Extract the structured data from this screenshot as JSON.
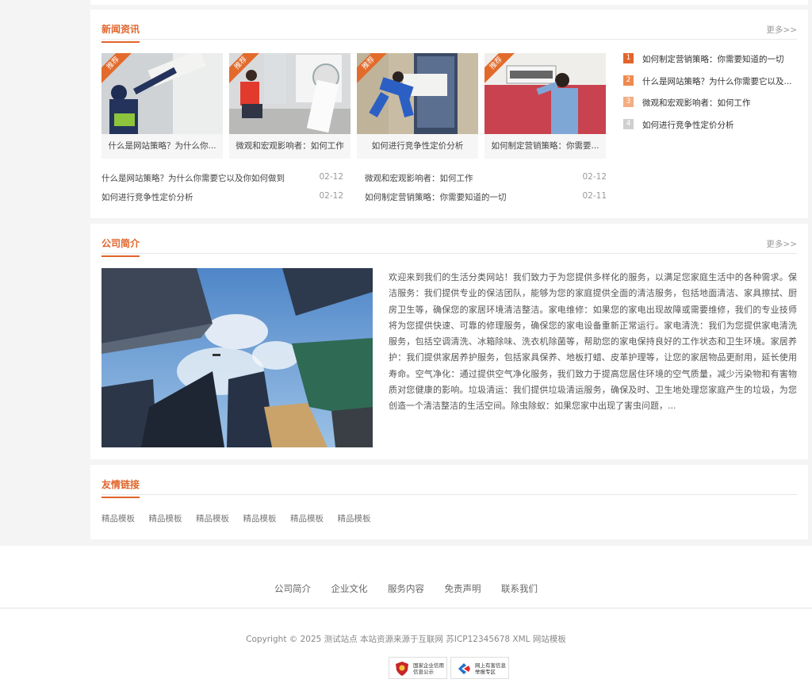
{
  "news": {
    "title": "新闻资讯",
    "more": "更多>>",
    "ribbon": "推荐",
    "thumbs": [
      {
        "caption": "什么是网站策略？为什么你..."
      },
      {
        "caption": "微观和宏观影响者：如何工作"
      },
      {
        "caption": "如何进行竞争性定价分析"
      },
      {
        "caption": "如何制定营销策略：你需要..."
      }
    ],
    "hot": [
      {
        "num": "1",
        "text": "如何制定营销策略：你需要知道的一切",
        "color": "#e0652b"
      },
      {
        "num": "2",
        "text": "什么是网站策略？为什么你需要它以及...",
        "color": "#ef8a4e"
      },
      {
        "num": "3",
        "text": "微观和宏观影响者：如何工作",
        "color": "#f2ad83"
      },
      {
        "num": "4",
        "text": "如何进行竞争性定价分析",
        "color": "#cfcfcf"
      }
    ],
    "list": [
      {
        "title": "什么是网站策略？为什么你需要它以及你如何做到",
        "date": "02-12"
      },
      {
        "title": "微观和宏观影响者：如何工作",
        "date": "02-12"
      },
      {
        "title": "如何进行竞争性定价分析",
        "date": "02-12"
      },
      {
        "title": "如何制定营销策略：你需要知道的一切",
        "date": "02-11"
      }
    ]
  },
  "about": {
    "title": "公司简介",
    "more": "更多>>",
    "text": "欢迎来到我们的生活分类网站！我们致力于为您提供多样化的服务，以满足您家庭生活中的各种需求。保洁服务：我们提供专业的保洁团队，能够为您的家庭提供全面的清洁服务，包括地面清洁、家具擦拭、厨房卫生等，确保您的家居环境清洁整洁。家电维修：如果您的家电出现故障或需要维修，我们的专业技师将为您提供快速、可靠的修理服务，确保您的家电设备重新正常运行。家电清洗：我们为您提供家电清洗服务，包括空调清洗、冰箱除味、洗衣机除菌等，帮助您的家电保持良好的工作状态和卫生环境。家居养护：我们提供家居养护服务，包括家具保养、地板打蜡、皮革护理等，让您的家居物品更耐用，延长使用寿命。空气净化：通过提供空气净化服务，我们致力于提高您居住环境的空气质量，减少污染物和有害物质对您健康的影响。垃圾清运：我们提供垃圾清运服务，确保及时、卫生地处理您家庭产生的垃圾，为您创造一个清洁整洁的生活空间。除虫除蚁：如果您家中出现了害虫问题，..."
  },
  "links": {
    "title": "友情链接",
    "items": [
      "精品模板",
      "精品模板",
      "精品模板",
      "精品模板",
      "精品模板",
      "精品模板"
    ]
  },
  "footer": {
    "nav": [
      "公司简介",
      "企业文化",
      "服务内容",
      "免责声明",
      "联系我们"
    ],
    "copyright": "Copyright © 2025 测试站点 本站资源来源于互联网 苏ICP12345678 XML 网站模板",
    "badges": [
      {
        "line1": "国家企业信用",
        "line2": "信息公示",
        "icon": "shield-icon"
      },
      {
        "line1": "网上有害信息",
        "line2": "举报专区",
        "icon": "report-icon"
      }
    ]
  },
  "colors": {
    "accent": "#e0652b",
    "ribbon": "#e26b2c"
  }
}
